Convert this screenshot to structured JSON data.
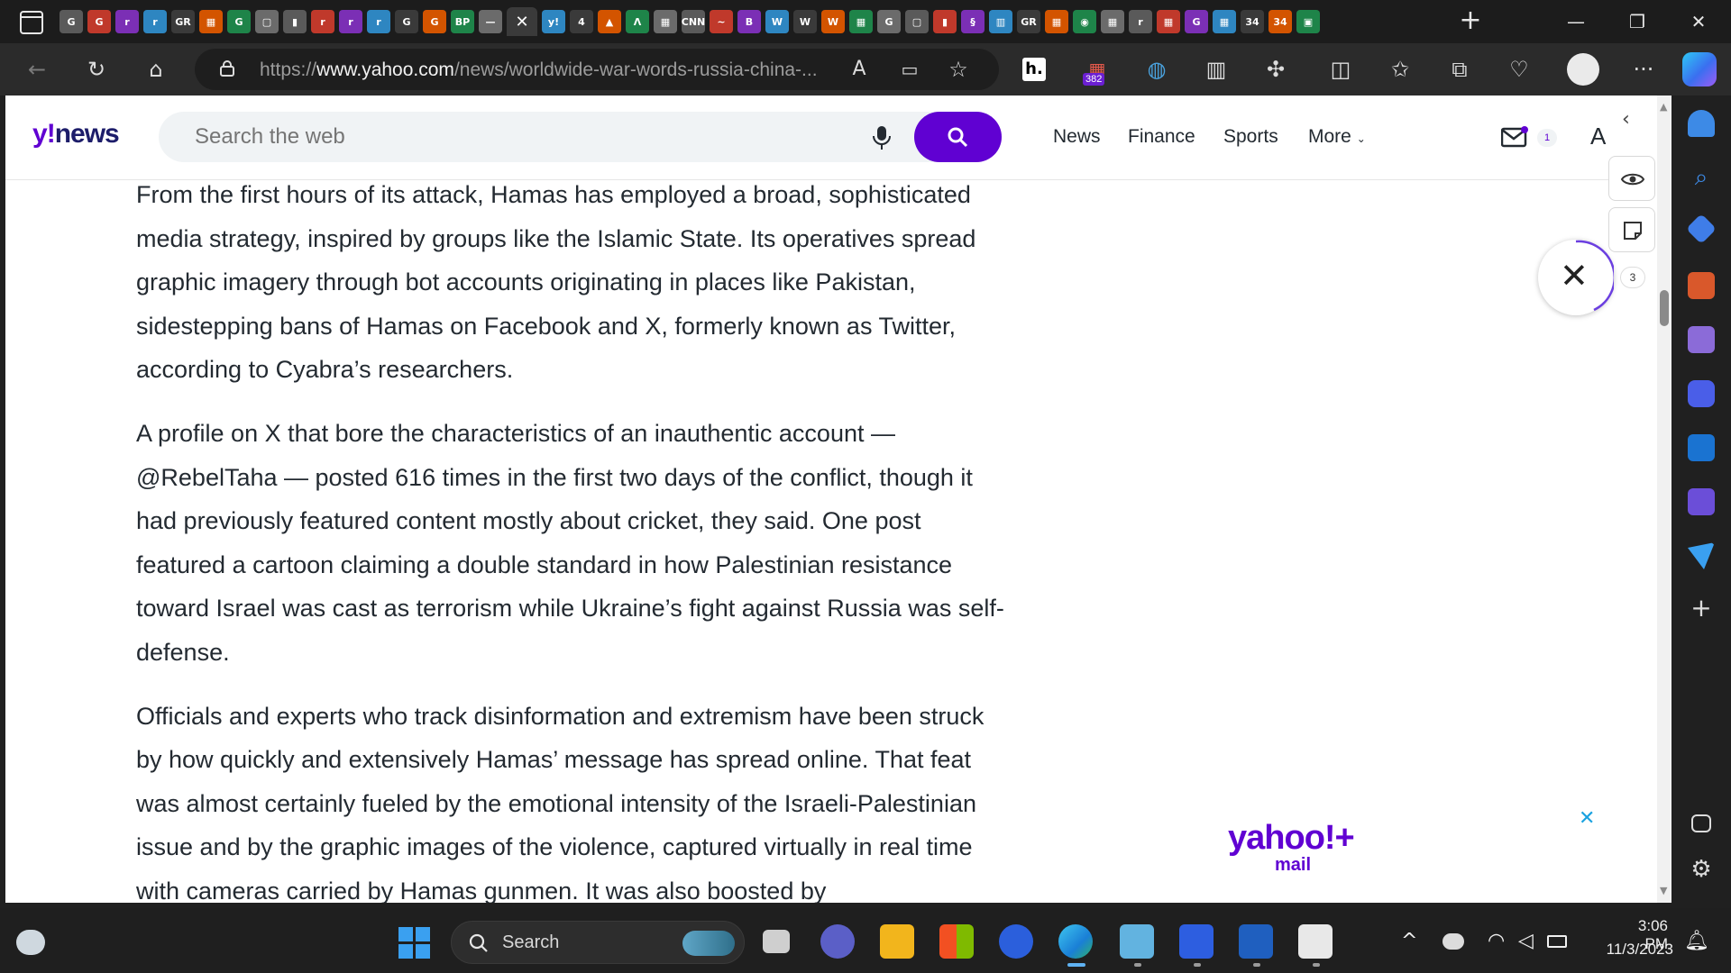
{
  "browser": {
    "tab_favicons": [
      "G",
      "G",
      "r",
      "r",
      "GR",
      "▦",
      "G",
      "▢",
      "▮",
      "r",
      "r",
      "r",
      "G",
      "G",
      "BP",
      "—"
    ],
    "active_tab_close": "✕",
    "tab_favicons_after": [
      "y!",
      "4",
      "▲",
      "Λ",
      "▦",
      "CNN",
      "~",
      "B",
      "W",
      "W",
      "W",
      "▦",
      "G",
      "▢",
      "▮",
      "§",
      "▥",
      "GR",
      "▦",
      "◉",
      "▦",
      "r",
      "▦",
      "G",
      "▦",
      "34",
      "34",
      "▣"
    ],
    "new_tab": "+",
    "window_controls": {
      "minimize": "—",
      "restore": "❐",
      "close": "✕"
    },
    "url_prefix": "https://",
    "url_host": "www.yahoo.com",
    "url_path": "/news/worldwide-war-words-russia-china-...",
    "read_aloud": "A",
    "extension_badge": "382",
    "more_menu": "···"
  },
  "yahoo": {
    "logo_y": "y",
    "logo_bang": "!",
    "logo_news": "news",
    "search_placeholder": "Search the web",
    "nav": [
      "News",
      "Finance",
      "Sports",
      "More"
    ],
    "mail_count": "1",
    "profile_initial": "A"
  },
  "article": {
    "paragraphs": [
      "From the first hours of its attack, Hamas has employed a broad, sophisticated media strategy, inspired by groups like the Islamic State. Its operatives spread graphic imagery through bot accounts originating in places like Pakistan, sidestepping bans of Hamas on Facebook and X, formerly known as Twitter, according to Cyabra’s researchers.",
      "A profile on X that bore the characteristics of an inauthentic account — @RebelTaha — posted 616 times in the first two days of the conflict, though it had previously featured content mostly about cricket, they said. One post featured a cartoon claiming a double standard in how Palestinian resistance toward Israel was cast as terrorism while Ukraine’s fight against Russia was self-defense.",
      "Officials and experts who track disinformation and extremism have been struck by how quickly and extensively Hamas’ message has spread online. That feat was almost certainly fueled by the emotional intensity of the Israeli-Palestinian issue and by the graphic images of the violence, captured virtually in real time with cameras carried by Hamas gunmen. It was also boosted by"
    ]
  },
  "widgets": {
    "collapse": "‹",
    "close": "✕",
    "count": "3",
    "ad_close": "✕",
    "ad_logo": "yahoo!+",
    "ad_sub": "mail"
  },
  "taskbar": {
    "search_label": "Search",
    "time": "3:06 PM",
    "date": "11/3/2023",
    "tray_chevron": "^"
  },
  "colors": {
    "yahoo_purple": "#6001d2",
    "tab_bg": "#1c1c1c",
    "toolbar_bg": "#2b2b2b",
    "taskbar_bg": "#1f1f1f"
  }
}
